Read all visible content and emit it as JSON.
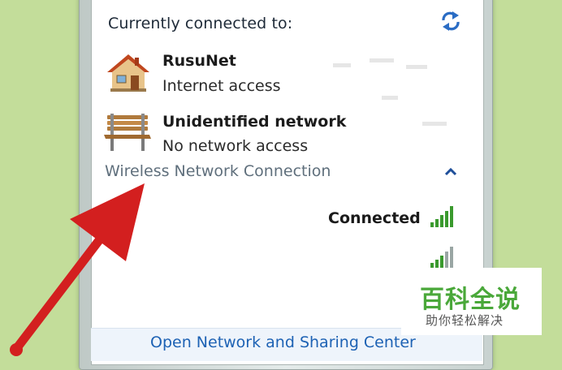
{
  "popup": {
    "heading": "Currently connected to:",
    "networks": [
      {
        "name": "RusuNet",
        "status": "Internet access",
        "icon": "house-icon"
      },
      {
        "name": "Unidentified network",
        "status": "No network access",
        "icon": "bench-icon"
      }
    ],
    "section_label": "Wireless Network Connection",
    "wireless_items": [
      {
        "status": "Connected",
        "icon": "signal-strength-icon"
      },
      {
        "status": "",
        "icon": "signal-strength-icon"
      }
    ],
    "footer_link": "Open Network and Sharing Center"
  },
  "watermark": {
    "title": "百科全说",
    "subtitle": "助你轻松解决"
  },
  "colors": {
    "background": "#c3dd9a",
    "link": "#1d62b4",
    "signal_green": "#3a9a2e",
    "arrow_red": "#d31f1f",
    "watermark_green": "#4aa83a"
  }
}
